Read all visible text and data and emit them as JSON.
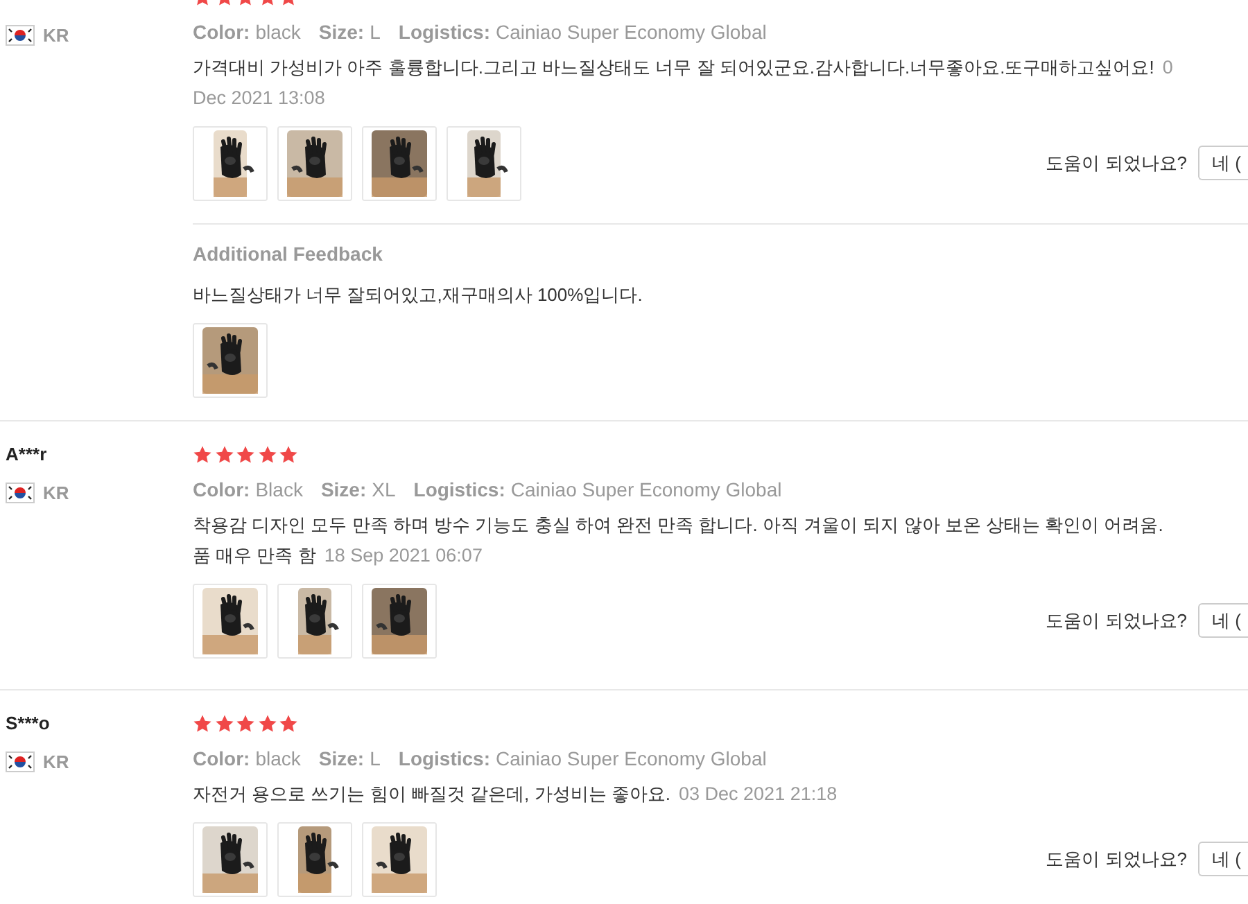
{
  "reviews": [
    {
      "country": "KR",
      "stars": 5,
      "meta": [
        {
          "label": "Color:",
          "value": "black"
        },
        {
          "label": "Size:",
          "value": "L"
        },
        {
          "label": "Logistics:",
          "value": "Cainiao Super Economy Global"
        }
      ],
      "lines": [
        [
          {
            "kind": "text",
            "text": "가격대비 가성비가 아주 훌륭합니다.그리고 바느질상태도 너무 잘 되어있군요.감사합니다.너무좋아요.또구매하고싶어요!"
          },
          {
            "kind": "date",
            "text": "0"
          }
        ],
        [
          {
            "kind": "date",
            "text": "Dec 2021 13:08"
          }
        ]
      ],
      "photos": [
        {
          "kind": "picture"
        },
        {
          "kind": "picture"
        },
        {
          "kind": "picture"
        },
        {
          "kind": "picture"
        }
      ],
      "helpful_label": "도움이 되었나요?",
      "helpful_button": "네 (",
      "additional": {
        "title": "Additional Feedback",
        "text": "바느질상태가 너무 잘되어있고,재구매의사 100%입니다.",
        "photos": [
          {
            "kind": "picture"
          }
        ]
      }
    },
    {
      "name": "A***r",
      "country": "KR",
      "stars": 5,
      "meta": [
        {
          "label": "Color:",
          "value": "Black"
        },
        {
          "label": "Size:",
          "value": "XL"
        },
        {
          "label": "Logistics:",
          "value": "Cainiao Super Economy Global"
        }
      ],
      "lines": [
        [
          {
            "kind": "text",
            "text": "착용감 디자인 모두 만족 하며 방수 기능도 충실 하여 완전 만족 합니다. 아직 겨울이 되지 않아 보온 상태는 확인이 어려움."
          }
        ],
        [
          {
            "kind": "text",
            "text": "품 매우 만족 함"
          },
          {
            "kind": "date",
            "text": "18 Sep 2021 06:07"
          }
        ]
      ],
      "photos": [
        {
          "kind": "picture"
        },
        {
          "kind": "picture"
        },
        {
          "kind": "picture"
        }
      ],
      "helpful_label": "도움이 되었나요?",
      "helpful_button": "네 ("
    },
    {
      "name": "S***o",
      "country": "KR",
      "stars": 5,
      "meta": [
        {
          "label": "Color:",
          "value": "black"
        },
        {
          "label": "Size:",
          "value": "L"
        },
        {
          "label": "Logistics:",
          "value": "Cainiao Super Economy Global"
        }
      ],
      "lines": [
        [
          {
            "kind": "text",
            "text": "자전거 용으로 쓰기는 힘이 빠질것 같은데, 가성비는 좋아요."
          },
          {
            "kind": "date",
            "text": "03 Dec 2021 21:18"
          }
        ]
      ],
      "photos": [
        {
          "kind": "picture"
        },
        {
          "kind": "picture"
        },
        {
          "kind": "picture"
        }
      ],
      "helpful_label": "도움이 되었나요?",
      "helpful_button": "네 ("
    }
  ]
}
